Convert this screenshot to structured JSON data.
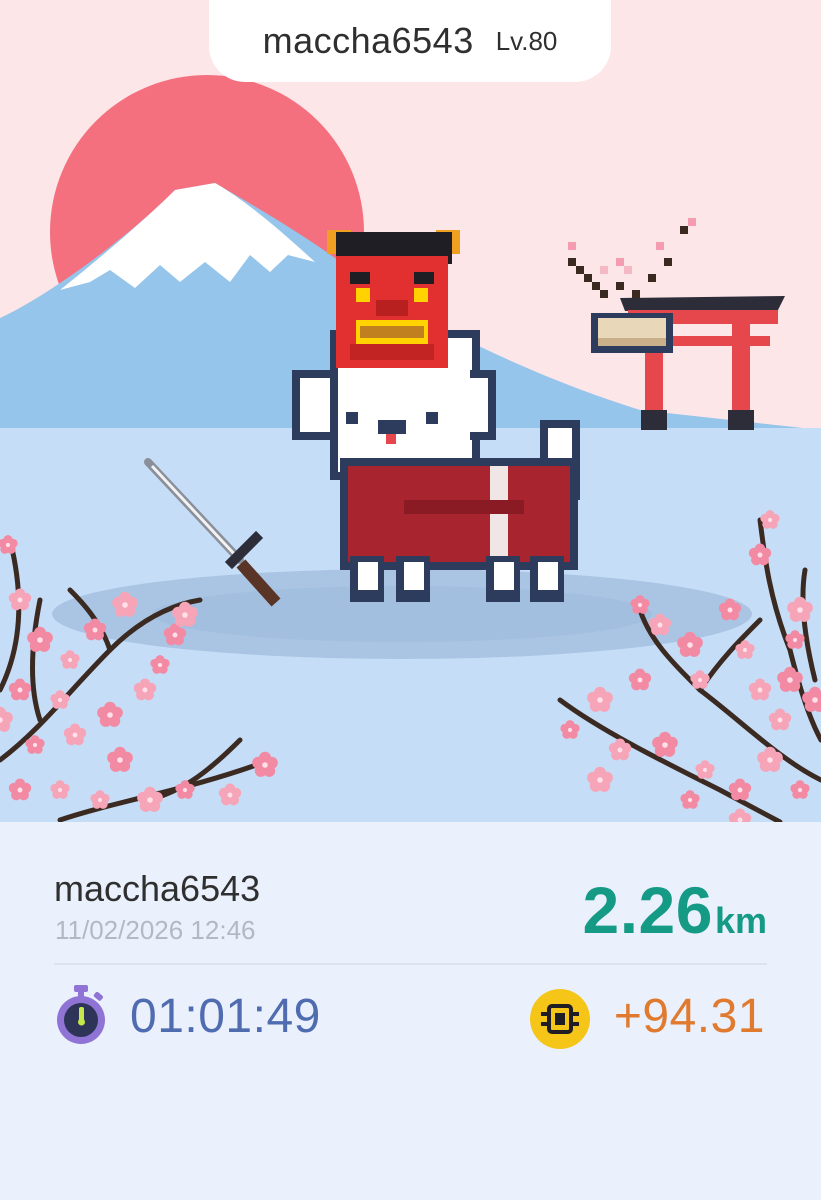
{
  "header": {
    "username": "maccha6543",
    "level": "Lv.80"
  },
  "scene": {
    "icons": [
      "rising-sun",
      "mount-fuji",
      "torii-gate",
      "cherry-blossom-branch",
      "pixel-dog-character",
      "oni-mask",
      "katana"
    ]
  },
  "summary": {
    "username": "maccha6543",
    "timestamp": "11/02/2026 12:46",
    "distance_value": "2.26",
    "distance_unit": "km",
    "duration": "01:01:49",
    "earned": "+94.31"
  },
  "colors": {
    "accent_distance": "#159a86",
    "duration": "#4f6cb1",
    "earned": "#e07a2e",
    "coin": "#f5c518",
    "sun": "#f4707f",
    "sky": "#fde6e8",
    "water": "#c6ddf7"
  },
  "icons": {
    "timer": "stopwatch-icon",
    "coin": "coin-icon"
  }
}
